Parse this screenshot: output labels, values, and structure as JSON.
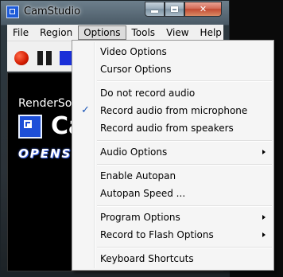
{
  "window": {
    "title": "CamStudio",
    "icon": "camstudio-app-icon"
  },
  "menubar": {
    "items": [
      {
        "label": "File"
      },
      {
        "label": "Region"
      },
      {
        "label": "Options"
      },
      {
        "label": "Tools"
      },
      {
        "label": "View"
      },
      {
        "label": "Help"
      }
    ]
  },
  "toolbar": {
    "buttons": [
      "record-icon",
      "pause-icon",
      "stop-icon"
    ]
  },
  "splash": {
    "brand": "RenderSof",
    "logo_text": "Ca",
    "open_text": "OPENS"
  },
  "options_menu": {
    "items": [
      {
        "label": "Video Options",
        "submenu": false,
        "checked": false
      },
      {
        "label": "Cursor Options",
        "submenu": false,
        "checked": false
      },
      {
        "label": "Do not record audio",
        "submenu": false,
        "checked": false
      },
      {
        "label": "Record audio from microphone",
        "submenu": false,
        "checked": true
      },
      {
        "label": "Record audio from speakers",
        "submenu": false,
        "checked": false
      },
      {
        "label": "Audio Options",
        "submenu": true,
        "checked": false
      },
      {
        "label": "Enable Autopan",
        "submenu": false,
        "checked": false
      },
      {
        "label": "Autopan Speed ...",
        "submenu": false,
        "checked": false
      },
      {
        "label": "Program Options",
        "submenu": true,
        "checked": false
      },
      {
        "label": "Record to Flash Options",
        "submenu": true,
        "checked": false
      },
      {
        "label": "Keyboard Shortcuts",
        "submenu": false,
        "checked": false
      }
    ],
    "check_glyph": "✓"
  },
  "colors": {
    "menu_bg": "#f5f5f5",
    "check": "#1b55b6",
    "record": "#d21b00",
    "stop": "#1a2fd8"
  }
}
